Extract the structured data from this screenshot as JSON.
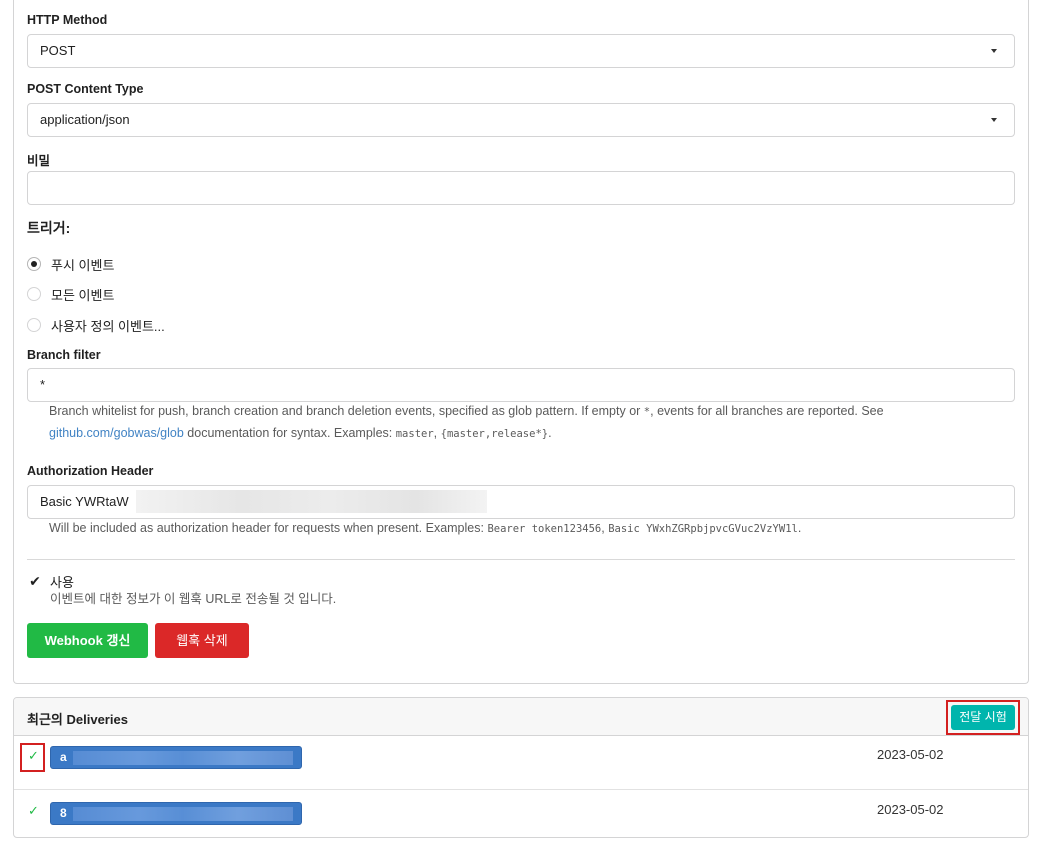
{
  "form": {
    "http_method": {
      "label": "HTTP Method",
      "value": "POST"
    },
    "content_type": {
      "label": "POST Content Type",
      "value": "application/json"
    },
    "secret": {
      "label": "비밀",
      "value": ""
    },
    "triggers": {
      "heading": "트리거:",
      "options": [
        {
          "label": "푸시 이벤트",
          "selected": true
        },
        {
          "label": "모든 이벤트",
          "selected": false
        },
        {
          "label": "사용자 정의 이벤트...",
          "selected": false
        }
      ]
    },
    "branch_filter": {
      "label": "Branch filter",
      "value": "*",
      "help_line1": "Branch whitelist for push, branch creation and branch deletion events, specified as glob pattern. If empty or ",
      "help_code_star": "*",
      "help_line1_end": ", events for all branches are reported. See",
      "help_link": "github.com/gobwas/glob",
      "help_line2": " documentation for syntax. Examples: ",
      "help_code_ex1": "master",
      "help_sep": ", ",
      "help_code_ex2": "{master,release*}",
      "help_end": "."
    },
    "auth_header": {
      "label": "Authorization Header",
      "value": "Basic YWRtaW",
      "help_prefix": "Will be included as authorization header for requests when present. Examples: ",
      "help_code_ex1": "Bearer token123456",
      "help_sep": ", ",
      "help_code_ex2": "Basic YWxhZGRpbjpvcGVuc2VzYW1l",
      "help_end": "."
    },
    "active": {
      "label": "사용",
      "checked": true,
      "help": "이벤트에 대한 정보가 이 웹훅 URL로 전송될 것 입니다."
    },
    "update_button": "Webhook 갱신",
    "delete_button": "웹훅 삭제"
  },
  "deliveries": {
    "title": "최근의 Deliveries",
    "test_button": "전달 시험",
    "items": [
      {
        "status": "success",
        "id_prefix": "a",
        "date": "2023-05-02"
      },
      {
        "status": "success",
        "id_prefix": "8",
        "date": "2023-05-02"
      }
    ]
  },
  "colors": {
    "primary_green": "#21ba45",
    "danger_red": "#db2828",
    "teal": "#00b5ad",
    "hash_blue": "#3b79c6",
    "link_blue": "#4183c4",
    "highlight_red": "#d32020"
  }
}
